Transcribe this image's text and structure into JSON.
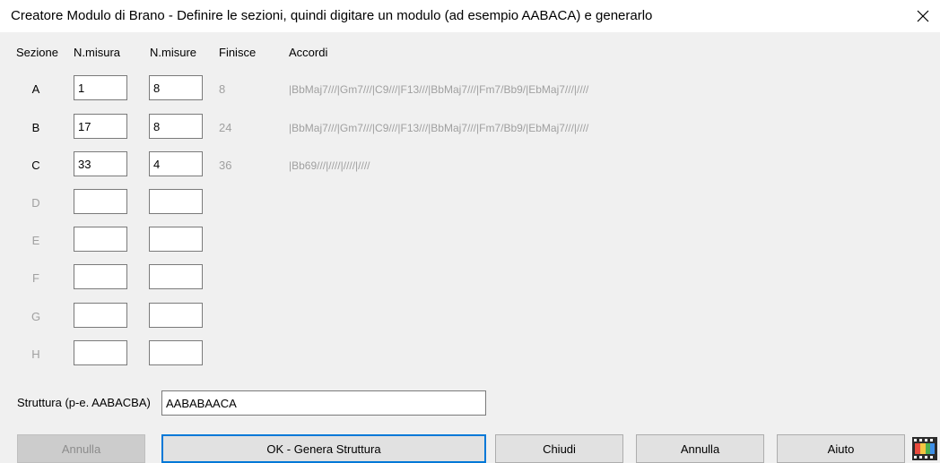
{
  "window": {
    "title": "Creatore Modulo di Brano - Definire le sezioni, quindi digitare un modulo (ad esempio AABACA) e generarlo"
  },
  "headers": {
    "section": "Sezione",
    "bar_number": "N.misura",
    "bar_count": "N.misure",
    "ends": "Finisce",
    "chords": "Accordi"
  },
  "sections": [
    {
      "label": "A",
      "start": "1",
      "length": "8",
      "ends": "8",
      "chords": "|BbMaj7///|Gm7///|C9///|F13///|BbMaj7///|Fm7/Bb9/|EbMaj7///|////"
    },
    {
      "label": "B",
      "start": "17",
      "length": "8",
      "ends": "24",
      "chords": "|BbMaj7///|Gm7///|C9///|F13///|BbMaj7///|Fm7/Bb9/|EbMaj7///|////"
    },
    {
      "label": "C",
      "start": "33",
      "length": "4",
      "ends": "36",
      "chords": "|Bb69///|////|////|////"
    },
    {
      "label": "D",
      "start": "",
      "length": "",
      "ends": "",
      "chords": ""
    },
    {
      "label": "E",
      "start": "",
      "length": "",
      "ends": "",
      "chords": ""
    },
    {
      "label": "F",
      "start": "",
      "length": "",
      "ends": "",
      "chords": ""
    },
    {
      "label": "G",
      "start": "",
      "length": "",
      "ends": "",
      "chords": ""
    },
    {
      "label": "H",
      "start": "",
      "length": "",
      "ends": "",
      "chords": ""
    }
  ],
  "structure": {
    "label": "Struttura (p-e. AABACBA)",
    "value": "AABABAACA"
  },
  "buttons": {
    "undo": "Annulla",
    "ok": "OK - Genera Struttura",
    "close": "Chiudi",
    "cancel": "Annulla",
    "help": "Aiuto"
  },
  "icons": {
    "close": "close-icon",
    "video": "film-icon"
  }
}
